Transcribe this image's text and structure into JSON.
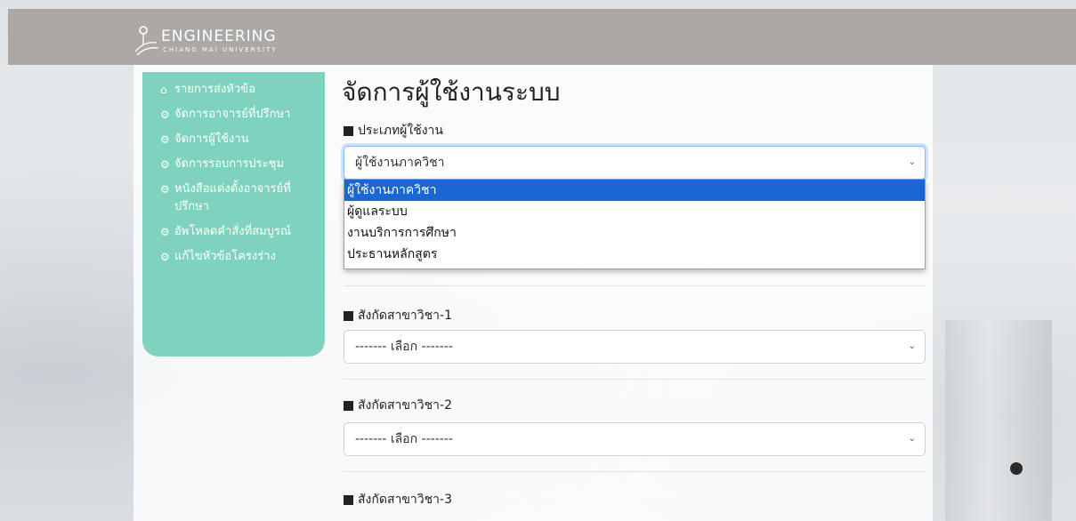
{
  "header": {
    "logo_title": "ENGINEERING",
    "logo_subtitle": "CHIANG MAI UNIVERSITY"
  },
  "sidebar": {
    "items": [
      {
        "icon": "home-icon",
        "label": "รายการส่งหัวข้อ"
      },
      {
        "icon": "gear-icon",
        "label": "จัดการอาจารย์ที่ปรึกษา"
      },
      {
        "icon": "gear-icon",
        "label": "จัดการผู้ใช้งาน"
      },
      {
        "icon": "gear-icon",
        "label": "จัดการรอบการประชุม"
      },
      {
        "icon": "gear-icon",
        "label": "หนังสือแต่งตั้งอาจารย์ที่ปรึกษา"
      },
      {
        "icon": "gear-icon",
        "label": "อัพโหลดคำสั่งที่สมบูรณ์"
      },
      {
        "icon": "gear-icon",
        "label": "แก้ไขหัวข้อโครงร่าง"
      }
    ]
  },
  "main": {
    "title": "จัดการผู้ใช้งานระบบ",
    "user_type": {
      "label": "ประเภทผู้ใช้งาน",
      "value": "ผู้ใช้งานภาควิชา",
      "options": [
        "ผู้ใช้งานภาควิชา",
        "ผู้ดูแลระบบ",
        "งานบริการการศึกษา",
        "ประธานหลักสูตร"
      ]
    },
    "dept1": {
      "label": "สังกัดสาขาวิชา-1",
      "value": "------- เลือก -------"
    },
    "dept2": {
      "label": "สังกัดสาขาวิชา-2",
      "value": "------- เลือก -------"
    },
    "dept3": {
      "label": "สังกัดสาขาวิชา-3"
    }
  },
  "colors": {
    "sidebar_bg": "#7fd2bd",
    "topbar_bg": "#aba8a6",
    "option_selected": "#1967d2"
  }
}
